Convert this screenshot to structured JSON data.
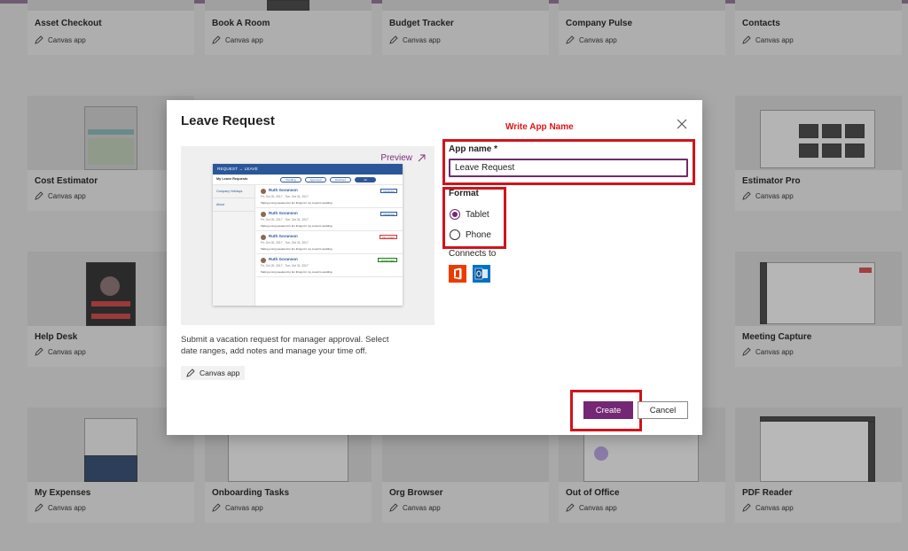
{
  "annotations": {
    "label": "Write App Name"
  },
  "gallery": {
    "canvas_label": "Canvas app",
    "row1": [
      "Asset Checkout",
      "Book A Room",
      "Budget Tracker",
      "Company Pulse",
      "Contacts"
    ],
    "row2": [
      "Cost Estimator",
      "Estimator Pro"
    ],
    "row3": [
      "Help Desk",
      "Meeting Capture"
    ],
    "row4": [
      "My Expenses",
      "Onboarding Tasks",
      "Org Browser",
      "Out of Office",
      "PDF Reader"
    ]
  },
  "modal": {
    "title": "Leave Request",
    "preview_label": "Preview",
    "description": "Submit a vacation request for manager approval. Select date ranges, add notes and manage your time off.",
    "tag": "Canvas app",
    "app_name_label": "App name *",
    "app_name_value": "Leave Request",
    "format_label": "Format",
    "format_options": [
      "Tablet",
      "Phone"
    ],
    "format_selected": "Tablet",
    "connects_label": "Connects to",
    "connectors": [
      "office-365-icon",
      "outlook-icon"
    ],
    "create_label": "Create",
    "cancel_label": "Cancel"
  },
  "mini_preview": {
    "header": "REQUEST → LEAVE",
    "list_title": "My Leave Requests",
    "filters": [
      "Pending",
      "Approved",
      "Declined",
      "All"
    ],
    "side_items": [
      "Company Holidays",
      "About"
    ],
    "items": [
      {
        "name": "Ruth Goranson",
        "dates": "Fri, Oct 20, 2017 - Tue, Oct 31, 2017",
        "note": "Taking a long weekend to fun things for my cousin's wedding.",
        "status": "PENDING"
      },
      {
        "name": "Ruth Goranson",
        "dates": "Fri, Oct 20, 2017 - Tue, Oct 31, 2017",
        "note": "Taking a long weekend to fun things for my cousin's wedding.",
        "status": "PENDING"
      },
      {
        "name": "Ruth Goranson",
        "dates": "Fri, Oct 20, 2017 - Tue, Oct 31, 2017",
        "note": "Taking a long weekend to fun things for my cousin's wedding.",
        "status": "DECLINED"
      },
      {
        "name": "Ruth Goranson",
        "dates": "Fri, Oct 20, 2017 - Tue, Oct 31, 2017",
        "note": "Taking a long weekend to fun things for my cousin's wedding.",
        "status": "APPROVED"
      }
    ]
  },
  "colors": {
    "accent": "#742774",
    "annotation_red": "#d0141b",
    "preview_blue": "#2b579a"
  }
}
